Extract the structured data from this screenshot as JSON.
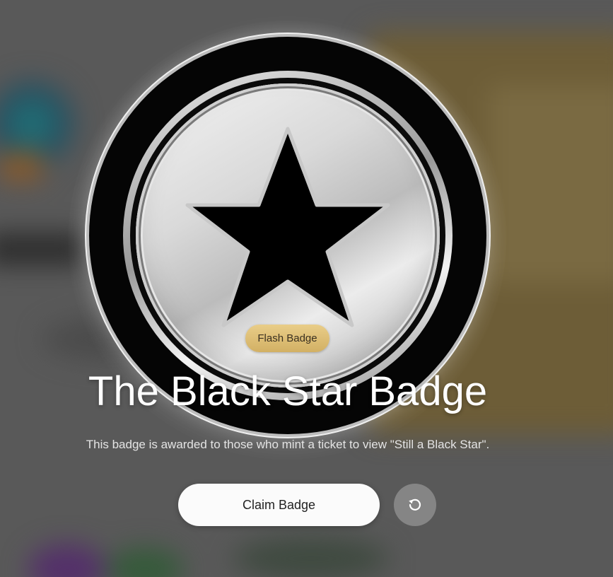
{
  "badge": {
    "type_label": "Flash Badge",
    "title": "The Black Star Badge",
    "description": "This badge is awarded to those who mint a ticket to view \"Still a Black Star\"."
  },
  "actions": {
    "claim_label": "Claim Badge",
    "reset_icon": "rotate-ccw-icon"
  },
  "colors": {
    "pill_gold": "#d9bb73",
    "claim_bg": "#fbfbfb",
    "reset_bg": "#858585"
  }
}
